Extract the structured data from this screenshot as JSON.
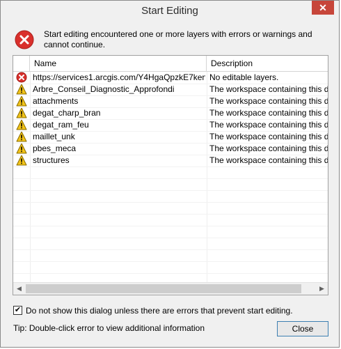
{
  "window": {
    "title": "Start Editing",
    "close_glyph": "✕"
  },
  "message": {
    "icon": "error-icon",
    "text": "Start editing encountered one or more layers with errors or warnings and cannot continue."
  },
  "grid": {
    "columns": [
      "Name",
      "Description"
    ],
    "rows": [
      {
        "type": "error",
        "name": "https://services1.arcgis.com/Y4HgaQpzkE7ken...",
        "description": "No editable layers."
      },
      {
        "type": "warning",
        "name": "Arbre_Conseil_Diagnostic_Approfondi",
        "description": "The workspace containing this data"
      },
      {
        "type": "warning",
        "name": "attachments",
        "description": "The workspace containing this data"
      },
      {
        "type": "warning",
        "name": "degat_charp_bran",
        "description": "The workspace containing this data"
      },
      {
        "type": "warning",
        "name": "degat_ram_feu",
        "description": "The workspace containing this data"
      },
      {
        "type": "warning",
        "name": "maillet_unk",
        "description": "The workspace containing this data"
      },
      {
        "type": "warning",
        "name": "pbes_meca",
        "description": "The workspace containing this data"
      },
      {
        "type": "warning",
        "name": "structures",
        "description": "The workspace containing this data"
      }
    ]
  },
  "options": {
    "checkbox_checked": true,
    "checkbox_label": "Do not show this dialog unless there are errors that prevent start editing."
  },
  "footer": {
    "tip": "Tip: Double-click error to view additional information",
    "close_label": "Close"
  },
  "colors": {
    "error": "#d9302c",
    "warning": "#f2c318",
    "close_button": "#c7463a"
  }
}
